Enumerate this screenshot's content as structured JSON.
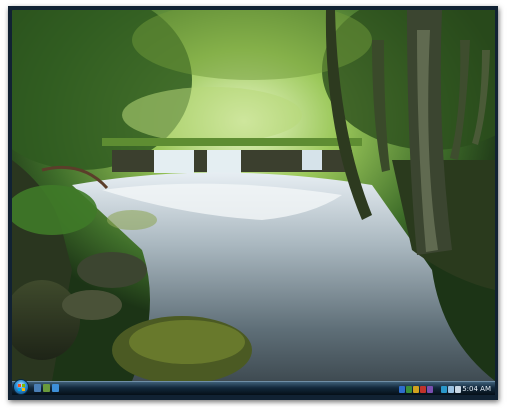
{
  "taskbar": {
    "clock": "5:04 AM"
  },
  "quick_launch": [
    {
      "name": "show-desktop-icon",
      "color": "#4a7fb6"
    },
    {
      "name": "switch-windows-icon",
      "color": "#6a9a3c"
    },
    {
      "name": "internet-explorer-icon",
      "color": "#3d8fd8"
    }
  ],
  "tray": [
    {
      "name": "tray-app-icon",
      "color": "#2e6dcc"
    },
    {
      "name": "tray-app-icon",
      "color": "#3c8f3a"
    },
    {
      "name": "tray-app-icon",
      "color": "#d0a21e"
    },
    {
      "name": "tray-app-icon",
      "color": "#c0332b"
    },
    {
      "name": "tray-app-icon",
      "color": "#7a4fb0"
    },
    {
      "name": "tray-app-icon",
      "color": "#2a97c9"
    },
    {
      "name": "network-icon",
      "color": "#9bc0df"
    },
    {
      "name": "volume-icon",
      "color": "#c9d7e4"
    }
  ]
}
